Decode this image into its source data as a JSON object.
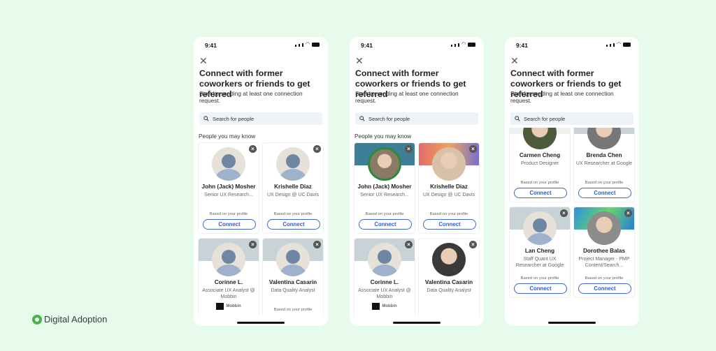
{
  "brand": {
    "name": "Digital Adoption",
    "color": "#4caf50"
  },
  "phones": [
    {
      "time": "9:41",
      "title": "Connect with former coworkers or friends to get referred",
      "subtitle": "Start by sending at least one connection request.",
      "search_placeholder": "Search for people",
      "section": "People you may know",
      "scrolled": false,
      "cards": [
        {
          "name": "John (Jack) Mosher",
          "headline": "Senior UX Research...",
          "based": "Based on your profile",
          "connect": "Connect",
          "banner": "",
          "photo": false
        },
        {
          "name": "Krishelle Diaz",
          "headline": "UX Design @ UC Davis",
          "based": "Based on your profile",
          "connect": "Connect",
          "banner": "",
          "photo": false
        },
        {
          "name": "Corinne L.",
          "headline": "Associate UX Analyst @ Mobbin",
          "company": "Mobbin",
          "banner": "#c7d3d6",
          "photo": false
        },
        {
          "name": "Valentina Casarin",
          "headline": "Data Quality Analyst",
          "based": "Based on your profile",
          "banner": "#c7d3d6",
          "photo": false
        }
      ]
    },
    {
      "time": "9:41",
      "title": "Connect with former coworkers or friends to get referred",
      "subtitle": "Start by sending at least one connection request.",
      "search_placeholder": "Search for people",
      "section": "People you may know",
      "scrolled": false,
      "cards": [
        {
          "name": "John (Jack) Mosher",
          "headline": "Senior UX Research...",
          "based": "Based on your profile",
          "connect": "Connect",
          "banner": "#3f7e97",
          "photo": "#8a7a66"
        },
        {
          "name": "Krishelle Diaz",
          "headline": "UX Design @ UC Davis",
          "based": "Based on your profile",
          "connect": "Connect",
          "banner": "#e8786a",
          "photo": "#d9c1a8"
        },
        {
          "name": "Corinne L.",
          "headline": "Associate UX Analyst @ Mobbin",
          "company": "Mobbin",
          "banner": "#c7d3d6",
          "photo": false
        },
        {
          "name": "Valentina Casarin",
          "headline": "Data Quality Analyst",
          "banner": "",
          "photo": "#3a3a3a"
        }
      ]
    },
    {
      "time": "9:41",
      "title": "Connect with former coworkers or friends to get referred",
      "subtitle": "Start by sending at least one connection request.",
      "search_placeholder": "Search for people",
      "section": "",
      "scrolled": true,
      "cards": [
        {
          "name": "Carmen Cheng",
          "headline": "Product Designer",
          "based": "Based on your profile",
          "connect": "Connect",
          "banner": "#eef0ee",
          "photo": "#4d5a3c"
        },
        {
          "name": "Brenda Chen",
          "headline": "UX Researcher at Google",
          "based": "Based on your profile",
          "connect": "Connect",
          "banner": "#c7d3d6",
          "photo": "#777777"
        },
        {
          "name": "Lan Cheng",
          "headline": "Staff Quant UX Researcher at Google",
          "based": "Based on your profile",
          "connect": "Connect",
          "banner": "#c7d3d6",
          "photo": false
        },
        {
          "name": "Dorothee Balas",
          "headline": "Project Manager - PMP Content/Search...",
          "based": "Based on your profile",
          "connect": "Connect",
          "banner": "#4fc48a",
          "photo": "#8c8c8c"
        }
      ]
    }
  ]
}
